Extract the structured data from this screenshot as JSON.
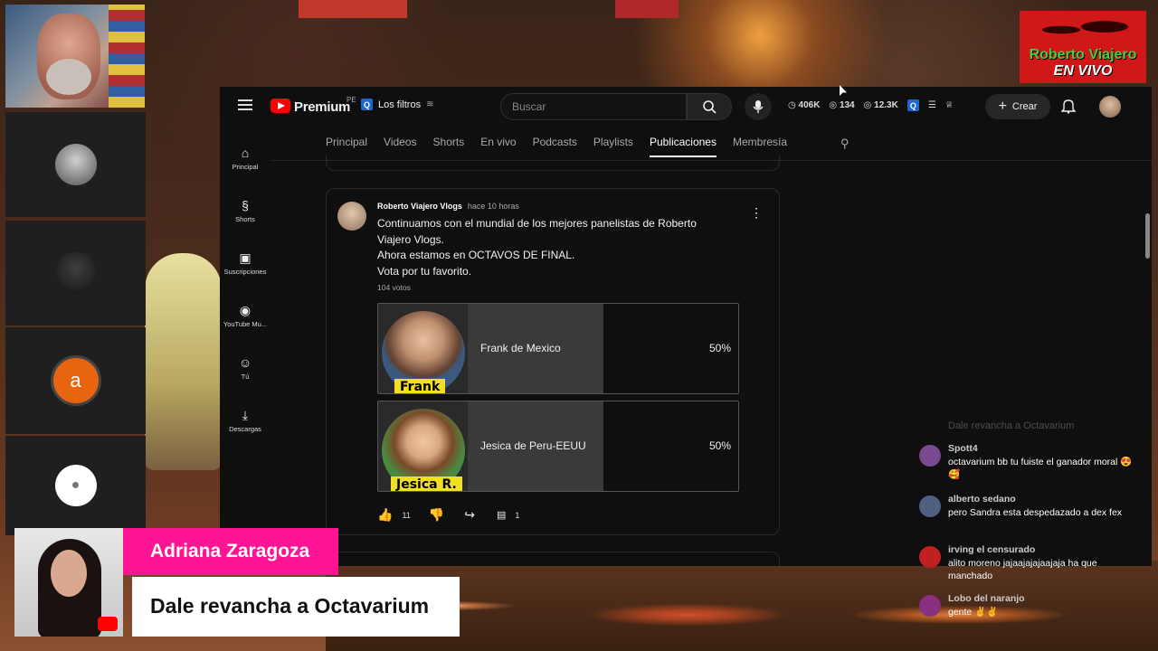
{
  "youtube": {
    "brand": "Premium",
    "country": "PE",
    "filters_label": "Los filtros",
    "search_placeholder": "Buscar",
    "stats": {
      "views": "406K",
      "watching": "134",
      "other": "12.3K"
    },
    "create_label": "Crear",
    "sidebar": [
      {
        "icon": "home-icon",
        "glyph": "⌂",
        "label": "Principal"
      },
      {
        "icon": "shorts-icon",
        "glyph": "§",
        "label": "Shorts"
      },
      {
        "icon": "subscriptions-icon",
        "glyph": "▣",
        "label": "Suscripciones"
      },
      {
        "icon": "youtube-music-icon",
        "glyph": "◉",
        "label": "YouTube Mu..."
      },
      {
        "icon": "you-icon",
        "glyph": "☺",
        "label": "Tú"
      },
      {
        "icon": "downloads-icon",
        "glyph": "⤓",
        "label": "Descargas"
      }
    ],
    "tabs": [
      "Principal",
      "Videos",
      "Shorts",
      "En vivo",
      "Podcasts",
      "Playlists",
      "Publicaciones",
      "Membresía"
    ],
    "active_tab": "Publicaciones",
    "post": {
      "author": "Roberto Viajero Vlogs",
      "time": "hace 10 horas",
      "lines": [
        "Continuamos con el mundial de los mejores panelistas de Roberto",
        "Viajero Vlogs.",
        "Ahora estamos en OCTAVOS DE FINAL.",
        "Vota por tu favorito."
      ],
      "votes": "104 votos",
      "options": [
        {
          "name": "Frank de Mexico",
          "percent": "50%",
          "fraction": 0.5,
          "tag": "Frank"
        },
        {
          "name": "Jesica de Peru-EEUU",
          "percent": "50%",
          "fraction": 0.5,
          "tag": "Jesica R."
        }
      ],
      "likes": "11",
      "comments": "1"
    }
  },
  "logo": {
    "line1": "Roberto Viajero",
    "line2": "EN VIVO"
  },
  "participants": [
    {
      "initial": "a",
      "color": "#e8650f"
    }
  ],
  "chat": {
    "faded": "Dale revancha a Octavarium",
    "messages": [
      {
        "name": "Spott4",
        "text": "octavarium bb tu fuiste el ganador moral 😍🥰",
        "color": "#7a4a90"
      },
      {
        "name": "alberto sedano",
        "text": "pero Sandra esta despedazado a dex fex",
        "color": "#506080"
      },
      {
        "name": "irving el censurado",
        "text": "alito moreno jajaajajajaajaja ha que manchado",
        "color": "#c02020"
      },
      {
        "name": "Lobo del naranjo",
        "text": "gente ✌✌",
        "color": "#8a3080"
      }
    ]
  },
  "lower_third": {
    "name": "Adriana Zaragoza",
    "message": "Dale revancha a Octavarium",
    "name_bg": "#ff1493"
  }
}
